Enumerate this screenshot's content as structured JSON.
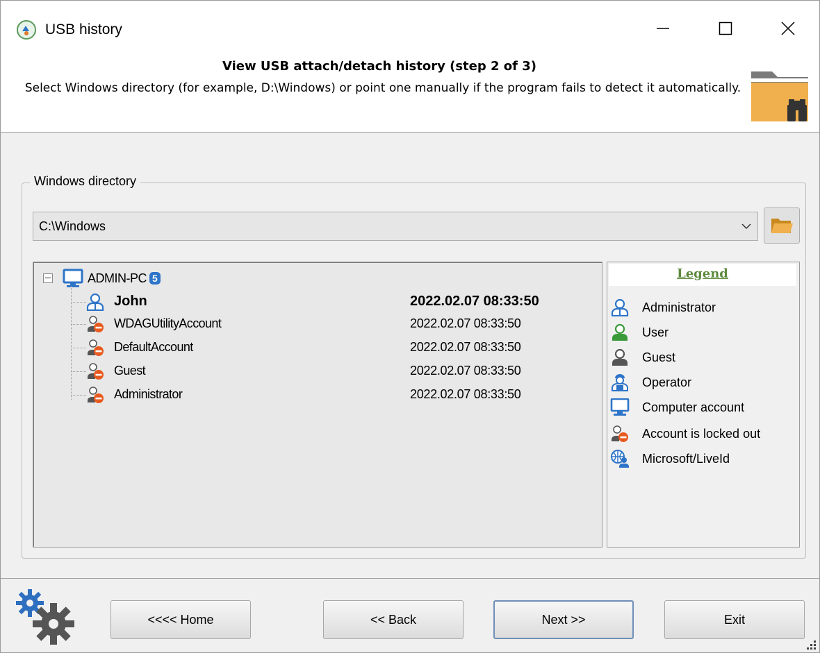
{
  "window": {
    "title": "USB history"
  },
  "header": {
    "title": "View USB attach/detach history (step 2 of 3)",
    "description": "Select Windows directory (for example, D:\\Windows) or point one manually if the program fails to detect it automatically."
  },
  "group": {
    "label": "Windows directory"
  },
  "directory": {
    "value": "C:\\Windows"
  },
  "tree": {
    "root": {
      "label": "ADMIN-PC",
      "count": "5"
    },
    "users": [
      {
        "name": "John",
        "date": "2022.02.07 08:33:50",
        "type": "administrator"
      },
      {
        "name": "WDAGUtilityAccount",
        "date": "2022.02.07 08:33:50",
        "type": "locked-out"
      },
      {
        "name": "DefaultAccount",
        "date": "2022.02.07 08:33:50",
        "type": "locked-out"
      },
      {
        "name": "Guest",
        "date": "2022.02.07 08:33:50",
        "type": "locked-out"
      },
      {
        "name": "Administrator",
        "date": "2022.02.07 08:33:50",
        "type": "locked-out"
      }
    ]
  },
  "legend": {
    "title": "Legend",
    "items": [
      {
        "label": "Administrator",
        "icon": "administrator-icon"
      },
      {
        "label": "User",
        "icon": "user-icon"
      },
      {
        "label": "Guest",
        "icon": "guest-icon"
      },
      {
        "label": "Operator",
        "icon": "operator-icon"
      },
      {
        "label": "Computer account",
        "icon": "computer-icon"
      },
      {
        "label": "Account is locked out",
        "icon": "locked-out-icon"
      },
      {
        "label": "Microsoft/LiveId",
        "icon": "microsoft-liveid-icon"
      }
    ]
  },
  "buttons": {
    "home": "<<<< Home",
    "back": "<< Back",
    "next": "Next >>",
    "exit": "Exit"
  },
  "colors": {
    "accent": "#2e74c8",
    "legend_title": "#5e8a3e",
    "folder": "#f0b04e"
  }
}
